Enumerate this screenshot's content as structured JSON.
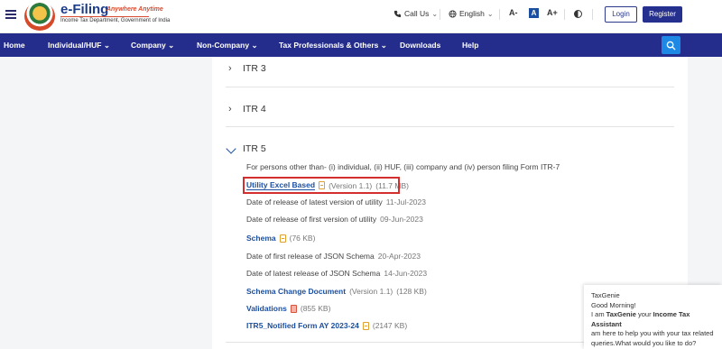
{
  "header": {
    "logo_title": "e-Filing",
    "logo_tagline": "Anywhere Anytime",
    "logo_subtitle": "Income Tax Department, Government of India",
    "call_us": "Call Us",
    "language": "English",
    "font_decrease": "A-",
    "font_normal": "A",
    "font_increase": "A+",
    "login": "Login",
    "register": "Register"
  },
  "nav": {
    "items": [
      "Home",
      "Individual/HUF",
      "Company",
      "Non-Company",
      "Tax Professionals & Others",
      "Downloads",
      "Help"
    ],
    "dropdown_marker": "⌄"
  },
  "accordion": {
    "collapsed": [
      "ITR 3",
      "ITR 4"
    ],
    "open_title": "ITR 5",
    "description": "For persons other than- (i) individual, (ii) HUF, (iii) company and (iv) person filing Form ITR-7",
    "utility_link": "Utility Excel Based",
    "utility_version": "(Version 1.1)",
    "utility_size": "(11.7 MB)",
    "latest_release_label": "Date of release of latest version of utility",
    "latest_release_value": "11-Jul-2023",
    "first_release_label": "Date of release of first version of utility",
    "first_release_value": "09-Jun-2023",
    "schema_link": "Schema",
    "schema_size": "(76 KB)",
    "first_json_label": "Date of first release of JSON Schema",
    "first_json_value": "20-Apr-2023",
    "latest_json_label": "Date of latest release of JSON Schema",
    "latest_json_value": "14-Jun-2023",
    "schema_change_link": "Schema Change Document",
    "schema_change_version": "(Version 1.1)",
    "schema_change_size": "(128 KB)",
    "validations_link": "Validations",
    "validations_size": "(855 KB)",
    "notified_link": "ITR5_Notified Form AY 2023-24",
    "notified_size": "(2147 KB)"
  },
  "chat": {
    "title": "TaxGenie",
    "greeting": "Good Morning!",
    "line_prefix": "I am ",
    "bot_name": "TaxGenie",
    "line_mid": " your ",
    "assistant": "Income Tax Assistant",
    "line2": "am here to help you with your tax related",
    "line3": "queries.What would you like to do?"
  },
  "colors": {
    "nav_bg": "#252d8c",
    "link": "#1c4fa0",
    "highlight": "#d32f2f"
  }
}
